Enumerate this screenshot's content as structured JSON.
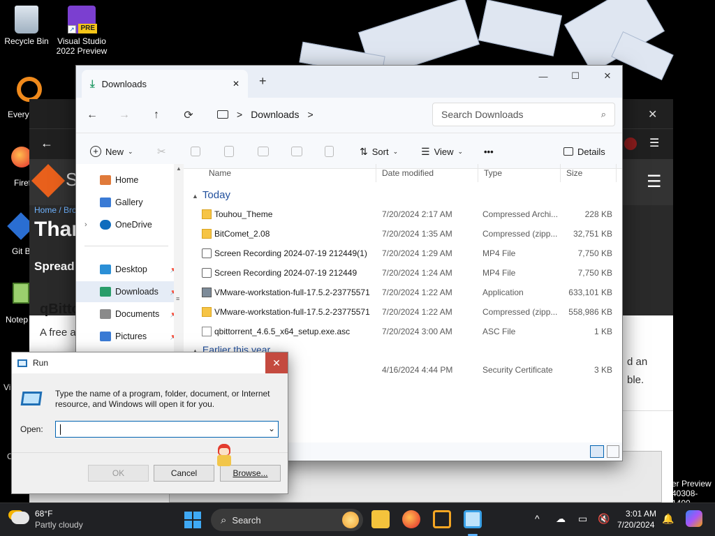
{
  "desktop": {
    "icons": [
      {
        "label1": "Recycle Bin",
        "label2": ""
      },
      {
        "label1": "Visual Studio",
        "label2": "2022 Preview",
        "badge": "PRE"
      }
    ],
    "partial_labels": [
      "Every",
      "Firef",
      "Git B",
      "Notep",
      "Vi",
      "C"
    ],
    "right_partial_1": "er Preview",
    "right_partial_2": "40308-1400"
  },
  "browser": {
    "breadcrumb": "Home / Bro",
    "hero_title": "Thar",
    "hero_sub": "Spread",
    "logo_letter": "S",
    "section_title": "qBitto",
    "body_text": "A free a",
    "right_text_1": "d an",
    "right_text_2": "ble."
  },
  "explorer": {
    "tab_title": "Downloads",
    "tab_close": "✕",
    "new_tab": "+",
    "win_min": "—",
    "win_max": "☐",
    "win_close": "✕",
    "path_root_icon": "monitor-icon",
    "path_current": "Downloads",
    "path_sep": ">",
    "search_placeholder": "Search Downloads",
    "cmd": {
      "new_label": "New",
      "sort_label": "Sort",
      "view_label": "View",
      "more_label": "•••",
      "details_label": "Details"
    },
    "nav": [
      {
        "label": "Home",
        "color": "#e07a3a",
        "pinned": false
      },
      {
        "label": "Gallery",
        "color": "#3a7bd5",
        "pinned": false
      },
      {
        "label": "OneDrive",
        "color": "#0f6cbd",
        "pinned": false
      },
      {
        "label": "Desktop",
        "color": "#2b8fd6",
        "pinned": true
      },
      {
        "label": "Downloads",
        "color": "#2a9d6a",
        "pinned": true
      },
      {
        "label": "Documents",
        "color": "#8a8a8a",
        "pinned": true
      },
      {
        "label": "Pictures",
        "color": "#3a7bd5",
        "pinned": true
      }
    ],
    "columns": [
      "Name",
      "Date modified",
      "Type",
      "Size"
    ],
    "groups": [
      "Today",
      "Earlier this year"
    ],
    "files": [
      {
        "name": "Touhou_Theme",
        "date": "7/20/2024 2:17 AM",
        "type": "Compressed Archi...",
        "size": "228 KB",
        "icon": "zip"
      },
      {
        "name": "BitComet_2.08",
        "date": "7/20/2024 1:35 AM",
        "type": "Compressed (zipp...",
        "size": "32,751 KB",
        "icon": "zip"
      },
      {
        "name": "Screen Recording 2024-07-19 212449(1)",
        "date": "7/20/2024 1:29 AM",
        "type": "MP4 File",
        "size": "7,750 KB",
        "icon": "mp4"
      },
      {
        "name": "Screen Recording 2024-07-19 212449",
        "date": "7/20/2024 1:24 AM",
        "type": "MP4 File",
        "size": "7,750 KB",
        "icon": "mp4"
      },
      {
        "name": "VMware-workstation-full-17.5.2-23775571",
        "date": "7/20/2024 1:22 AM",
        "type": "Application",
        "size": "633,101 KB",
        "icon": "app"
      },
      {
        "name": "VMware-workstation-full-17.5.2-23775571",
        "date": "7/20/2024 1:22 AM",
        "type": "Compressed (zipp...",
        "size": "558,986 KB",
        "icon": "zip"
      },
      {
        "name": "qbittorrent_4.6.5_x64_setup.exe.asc",
        "date": "7/20/2024 3:00 AM",
        "type": "ASC File",
        "size": "1 KB",
        "icon": "doc"
      }
    ],
    "earlier_files": [
      {
        "name": "",
        "date": "4/16/2024 4:44 PM",
        "type": "Security Certificate",
        "size": "3 KB",
        "icon": "doc"
      }
    ]
  },
  "run": {
    "title": "Run",
    "close": "✕",
    "description": "Type the name of a program, folder, document, or Internet resource, and Windows will open it for you.",
    "open_label": "Open:",
    "open_value": "",
    "ok": "OK",
    "cancel": "Cancel",
    "browse": "Browse..."
  },
  "taskbar": {
    "weather_temp": "68°F",
    "weather_desc": "Partly cloudy",
    "search_label": "Search",
    "time": "3:01 AM",
    "date": "7/20/2024"
  }
}
